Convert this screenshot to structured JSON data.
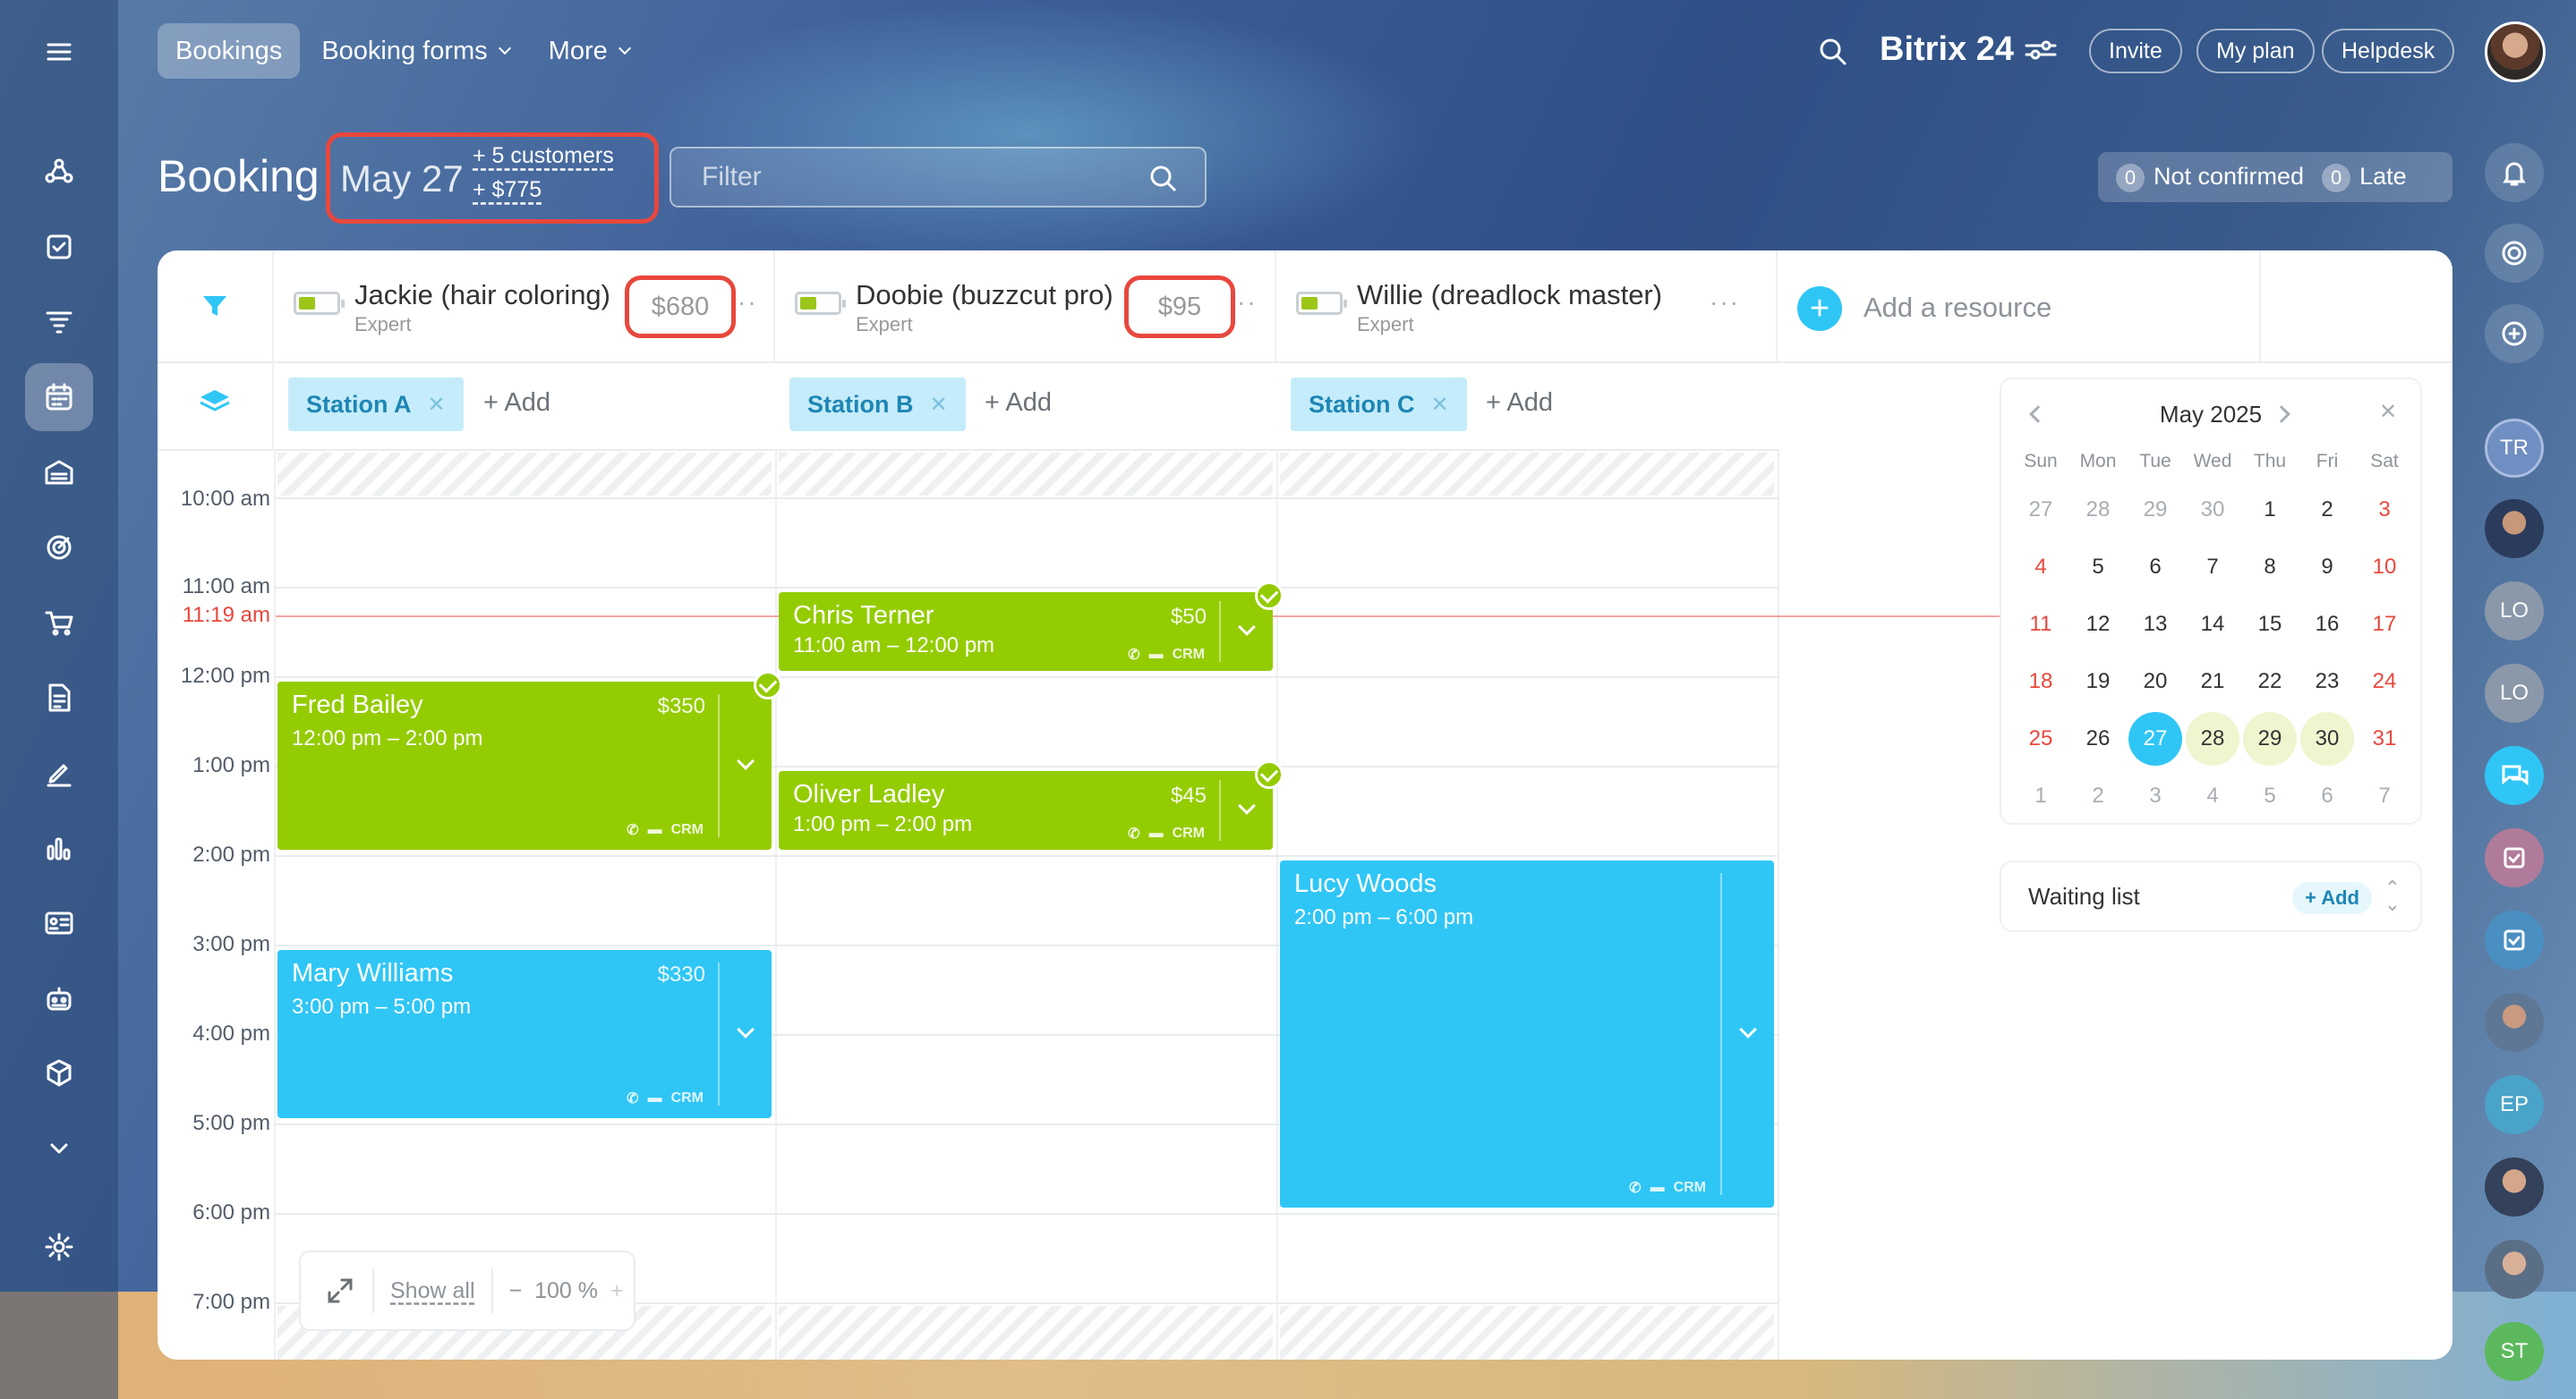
{
  "topnav": {
    "bookings": "Bookings",
    "booking_forms": "Booking forms",
    "more": "More"
  },
  "header": {
    "logo": "Bitrix 24",
    "invite": "Invite",
    "my_plan": "My plan",
    "helpdesk": "Helpdesk"
  },
  "page": {
    "title": "Booking",
    "date": "May 27",
    "customers": "+ 5 customers",
    "revenue": "+ $775",
    "filter_placeholder": "Filter",
    "not_confirmed_count": "0",
    "not_confirmed_label": "Not confirmed",
    "late_count": "0",
    "late_label": "Late"
  },
  "resources": [
    {
      "name": "Jackie (hair coloring)",
      "role": "Expert",
      "total": "$680",
      "station": "Station A"
    },
    {
      "name": "Doobie (buzzcut pro)",
      "role": "Expert",
      "total": "$95",
      "station": "Station B"
    },
    {
      "name": "Willie (dreadlock master)",
      "role": "Expert",
      "total": "",
      "station": "Station C"
    }
  ],
  "add_resource": "Add a resource",
  "add_station": "+ Add",
  "times": [
    "10:00 am",
    "11:00 am",
    "12:00 pm",
    "1:00 pm",
    "2:00 pm",
    "3:00 pm",
    "4:00 pm",
    "5:00 pm",
    "6:00 pm",
    "7:00 pm"
  ],
  "now_time": "11:19 am",
  "events": [
    {
      "name": "Fred Bailey",
      "time": "12:00 pm – 2:00 pm",
      "price": "$350",
      "crm": "CRM"
    },
    {
      "name": "Mary Williams",
      "time": "3:00 pm – 5:00 pm",
      "price": "$330",
      "crm": "CRM"
    },
    {
      "name": "Chris Terner",
      "time": "11:00 am – 12:00 pm",
      "price": "$50",
      "crm": "CRM"
    },
    {
      "name": "Oliver Ladley",
      "time": "1:00 pm – 2:00 pm",
      "price": "$45",
      "crm": "CRM"
    },
    {
      "name": "Lucy Woods",
      "time": "2:00 pm – 6:00 pm",
      "price": "",
      "crm": "CRM"
    }
  ],
  "calendar": {
    "month": "May 2025",
    "dow": [
      "Sun",
      "Mon",
      "Tue",
      "Wed",
      "Thu",
      "Fri",
      "Sat"
    ],
    "days": [
      "27",
      "28",
      "29",
      "30",
      "1",
      "2",
      "3",
      "4",
      "5",
      "6",
      "7",
      "8",
      "9",
      "10",
      "11",
      "12",
      "13",
      "14",
      "15",
      "16",
      "17",
      "18",
      "19",
      "20",
      "21",
      "22",
      "23",
      "24",
      "25",
      "26",
      "27",
      "28",
      "29",
      "30",
      "31",
      "1",
      "2",
      "3",
      "4",
      "5",
      "6",
      "7"
    ]
  },
  "waiting_list": {
    "label": "Waiting list",
    "add": "+ Add"
  },
  "zoom": {
    "show_all": "Show all",
    "minus": "−",
    "level": "100 %",
    "plus": "+"
  },
  "right_sidebar": {
    "avatars": [
      "TR",
      "LO",
      "LO",
      "EP",
      "ST"
    ]
  },
  "colors": {
    "green": "#94cc02",
    "blue": "#2fc6f6",
    "highlight": "#e8473d",
    "station": "#c5ecfa"
  }
}
